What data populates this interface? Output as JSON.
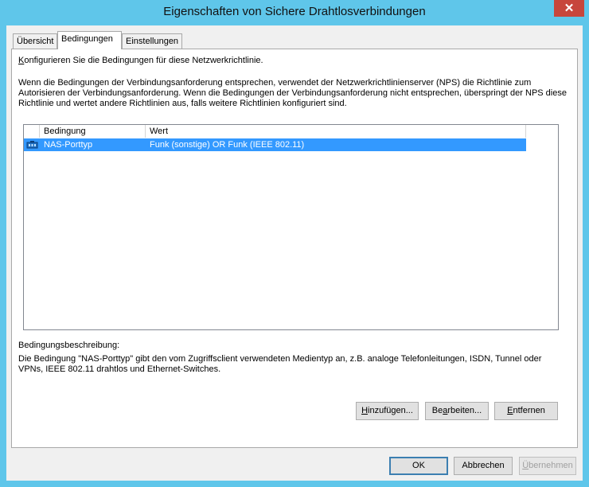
{
  "window": {
    "title": "Eigenschaften von Sichere Drahtlosverbindungen",
    "close_label": "✕"
  },
  "tabs": [
    {
      "label": "Übersicht",
      "active": false
    },
    {
      "label": "Bedingungen",
      "active": true
    },
    {
      "label": "Einstellungen",
      "active": false
    }
  ],
  "panel": {
    "intro_prefix": "K",
    "intro_rest": "onfigurieren Sie die Bedingungen für diese Netzwerkrichtlinie.",
    "description_lines": [
      "Wenn die Bedingungen der Verbindungsanforderung entsprechen, verwendet der Netzwerkrichtlinienserver (NPS) die Richtlinie zum",
      "Autorisieren der Verbindungsanforderung. Wenn die Bedingungen der Verbindungsanforderung nicht entsprechen, überspringt der NPS diese",
      "Richtlinie und wertet andere Richtlinien aus, falls weitere Richtlinien konfiguriert sind."
    ],
    "list": {
      "columns": [
        "Bedingung",
        "Wert"
      ],
      "rows": [
        {
          "icon": "network-condition-icon",
          "condition": "NAS-Porttyp",
          "value": "Funk (sonstige) OR Funk (IEEE 802.11)",
          "selected": true
        }
      ]
    },
    "condition_description_label": "Bedingungsbeschreibung:",
    "condition_description_lines": [
      "Die Bedingung \"NAS-Porttyp\" gibt den vom Zugriffsclient verwendeten Medientyp an, z.B. analoge Telefonleitungen, ISDN, Tunnel oder",
      "VPNs, IEEE 802.11 drahtlos und Ethernet-Switches."
    ],
    "buttons": {
      "add": {
        "underline": "H",
        "rest": "inzufügen..."
      },
      "edit": {
        "pre": "Be",
        "underline": "a",
        "rest": "rbeiten..."
      },
      "remove": {
        "underline": "E",
        "rest": "ntfernen"
      }
    }
  },
  "footer": {
    "ok": "OK",
    "cancel": "Abbrechen",
    "apply_underline": "Ü",
    "apply_rest": "bernehmen"
  },
  "colors": {
    "titlebar": "#5fc6ea",
    "selection": "#3399ff",
    "close": "#c7463c"
  }
}
